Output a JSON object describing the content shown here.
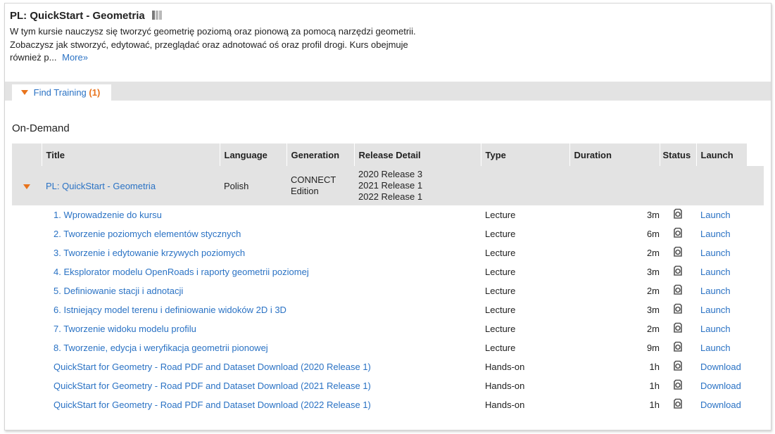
{
  "course": {
    "title": "PL: QuickStart - Geometria",
    "description": "W tym kursie nauczysz się tworzyć geometrię poziomą oraz pionową za pomocą narzędzi geometrii. Zobaczysz jak stworzyć, edytować, przeglądać oraz adnotować oś oraz profil drogi. Kurs obejmuje również p...",
    "more_link": "More»"
  },
  "tab": {
    "label": "Find Training",
    "count": "(1)"
  },
  "section_title": "On-Demand",
  "table": {
    "headers": [
      "Title",
      "Language",
      "Generation",
      "Release Detail",
      "Type",
      "Duration",
      "Status",
      "Launch"
    ],
    "group": {
      "title": "PL: QuickStart - Geometria",
      "language": "Polish",
      "generation": [
        "CONNECT",
        "Edition"
      ],
      "release_detail": [
        "2020 Release 3",
        "2021 Release 1",
        "2022 Release 1"
      ]
    },
    "items": [
      {
        "title": "1. Wprowadzenie do kursu",
        "type": "Lecture",
        "duration": "3m",
        "action": "Launch"
      },
      {
        "title": "2. Tworzenie poziomych elementów stycznych",
        "type": "Lecture",
        "duration": "6m",
        "action": "Launch"
      },
      {
        "title": "3. Tworzenie i edytowanie krzywych poziomych",
        "type": "Lecture",
        "duration": "2m",
        "action": "Launch"
      },
      {
        "title": "4. Eksplorator modelu OpenRoads i raporty geometrii poziomej",
        "type": "Lecture",
        "duration": "3m",
        "action": "Launch"
      },
      {
        "title": "5. Definiowanie stacji i adnotacji",
        "type": "Lecture",
        "duration": "2m",
        "action": "Launch"
      },
      {
        "title": "6. Istniejący model terenu i definiowanie widoków 2D i 3D",
        "type": "Lecture",
        "duration": "3m",
        "action": "Launch"
      },
      {
        "title": "7. Tworzenie widoku modelu profilu",
        "type": "Lecture",
        "duration": "2m",
        "action": "Launch"
      },
      {
        "title": "8. Tworzenie, edycja i weryfikacja geometrii pionowej",
        "type": "Lecture",
        "duration": "9m",
        "action": "Launch"
      },
      {
        "title": "QuickStart for Geometry - Road PDF and Dataset Download (2020 Release 1)",
        "type": "Hands-on",
        "duration": "1h",
        "action": "Download"
      },
      {
        "title": "QuickStart for Geometry - Road PDF and Dataset Download (2021 Release 1)",
        "type": "Hands-on",
        "duration": "1h",
        "action": "Download"
      },
      {
        "title": "QuickStart for Geometry - Road PDF and Dataset Download (2022 Release 1)",
        "type": "Hands-on",
        "duration": "1h",
        "action": "Download"
      }
    ],
    "status_icon": "camera-icon"
  },
  "colors": {
    "link": "#2a72c4",
    "accent": "#e8731c",
    "header_bg": "#e3e3e3"
  }
}
